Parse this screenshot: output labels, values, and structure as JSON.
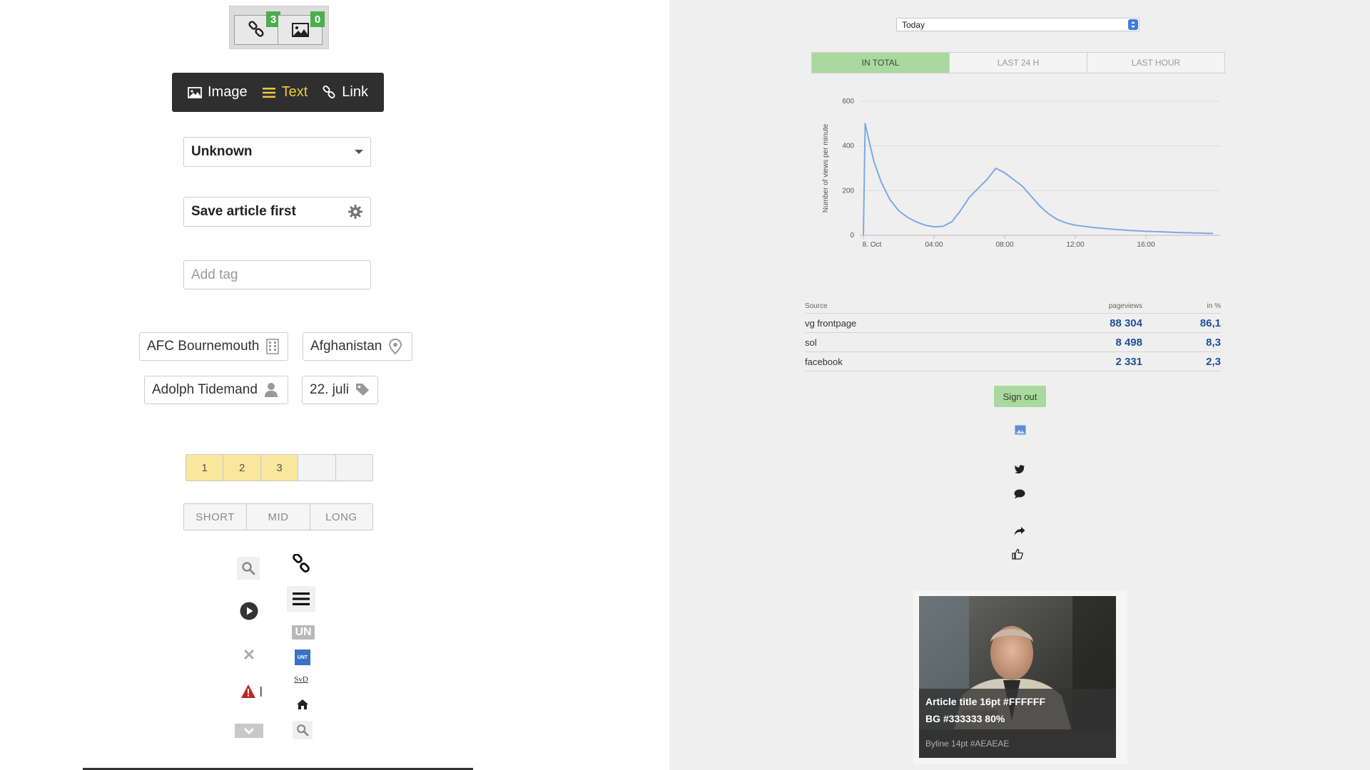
{
  "left_panel": {
    "counters": [
      {
        "icon": "link-icon",
        "count": "3"
      },
      {
        "icon": "image-icon",
        "count": "0"
      }
    ],
    "type_selector": [
      {
        "icon": "image-icon",
        "label": "Image",
        "active": false
      },
      {
        "icon": "list-icon",
        "label": "Text",
        "active": true
      },
      {
        "icon": "link-icon",
        "label": "Link",
        "active": false
      }
    ],
    "status_select": {
      "value": "Unknown"
    },
    "save_field": {
      "label": "Save article first"
    },
    "tag_input": {
      "placeholder": "Add tag"
    },
    "tags": [
      {
        "label": "AFC Bournemouth",
        "icon": "building-icon"
      },
      {
        "label": "Afghanistan",
        "icon": "map-pin-icon"
      },
      {
        "label": "Adolph Tidemand",
        "icon": "person-icon"
      },
      {
        "label": "22. juli",
        "icon": "tag-icon"
      }
    ],
    "rating": {
      "cells": [
        "1",
        "2",
        "3",
        "",
        ""
      ],
      "selected": 3
    },
    "length_options": [
      "SHORT",
      "MID",
      "LONG"
    ],
    "icons_col1": [
      "search-icon",
      "play-icon",
      "close-icon",
      "warning-icon",
      "chevron-down-icon"
    ],
    "icons_col2": [
      "link-icon",
      "menu-icon",
      "un-badge-icon",
      "unt-logo-icon",
      "svd-logo-icon",
      "home-icon",
      "search-icon"
    ],
    "un_label": "UN",
    "unt_label": "UNT",
    "svd_label": "SvD"
  },
  "right_panel": {
    "date_select": {
      "value": "Today"
    },
    "range_tabs": [
      {
        "label": "IN TOTAL",
        "active": true
      },
      {
        "label": "LAST 24 H",
        "active": false
      },
      {
        "label": "LAST HOUR",
        "active": false
      }
    ],
    "chart_data": {
      "type": "line",
      "title": "",
      "xlabel": "",
      "ylabel": "Number of views per minute",
      "ylim": [
        0,
        600
      ],
      "yticks": [
        "0",
        "200",
        "400",
        "600"
      ],
      "xticks": [
        "8. Oct",
        "04:00",
        "08:00",
        "12:00",
        "16:00"
      ],
      "x_hours": [
        0,
        0.1,
        0.3,
        0.6,
        1,
        1.5,
        2,
        2.5,
        3,
        3.5,
        4,
        4.5,
        5,
        5.5,
        6,
        6.5,
        7,
        7.5,
        8,
        8.5,
        9,
        9.5,
        10,
        10.5,
        11,
        11.5,
        12,
        13,
        14,
        15,
        16,
        17,
        18,
        19,
        19.8
      ],
      "values": [
        0,
        500,
        430,
        330,
        240,
        160,
        110,
        80,
        60,
        45,
        38,
        40,
        60,
        110,
        170,
        210,
        250,
        300,
        280,
        250,
        220,
        175,
        130,
        95,
        70,
        55,
        45,
        35,
        28,
        22,
        18,
        15,
        12,
        10,
        8
      ],
      "color": "#7fa8e6",
      "grid": true
    },
    "sources_table": {
      "headers": [
        "Source",
        "pageviews",
        "in %"
      ],
      "rows": [
        [
          "vg frontpage",
          "88 304",
          "86,1"
        ],
        [
          "sol",
          "8 498",
          "8,3"
        ],
        [
          "facebook",
          "2 331",
          "2,3"
        ]
      ]
    },
    "signout_label": "Sign out",
    "social_icons": [
      "image-icon",
      "twitter-icon",
      "comment-icon",
      "share-icon",
      "thumbs-up-icon"
    ],
    "card": {
      "title_line1": "Article title 16pt #FFFFFF",
      "title_line2": "BG  #333333 80%",
      "byline": "Byline 14pt #AEAEAE"
    }
  },
  "colors": {
    "accent_green": "#a9d99e",
    "badge_green": "#4cae4c",
    "highlight_yellow": "#f0c83c",
    "number_blue": "#1f4f9c",
    "line_blue": "#7fa8e6"
  }
}
